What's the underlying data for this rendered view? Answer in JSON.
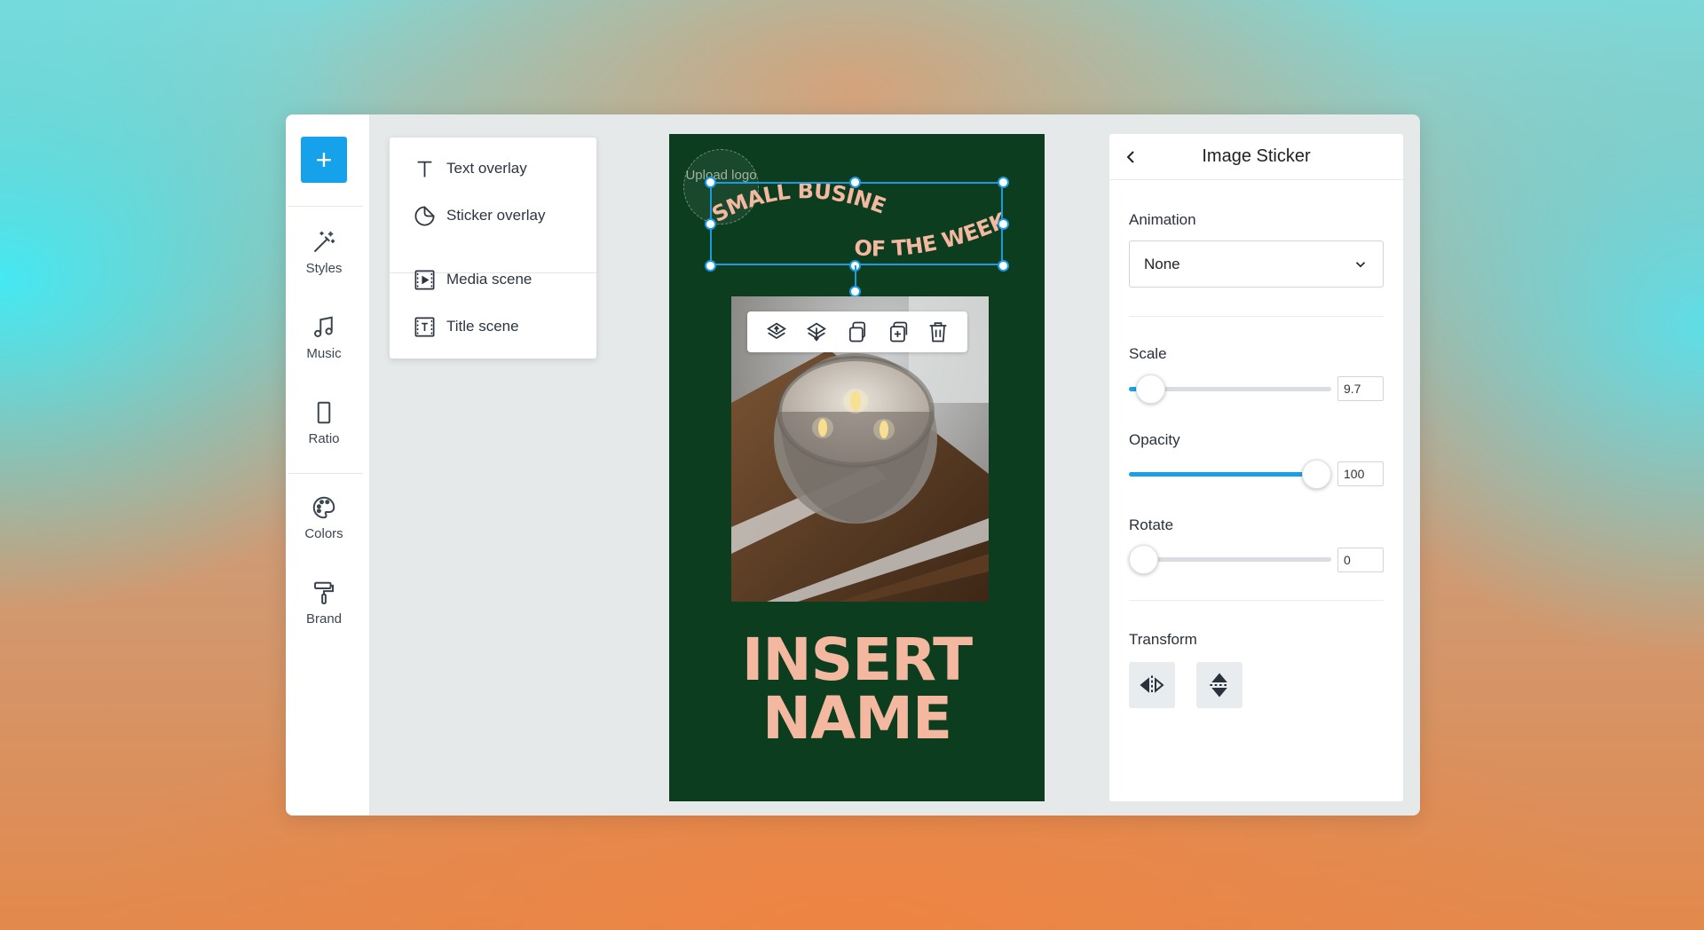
{
  "toolbar": {
    "add_label": "+"
  },
  "rail": {
    "items": [
      {
        "label": "Styles",
        "icon": "magic-wand-icon"
      },
      {
        "label": "Music",
        "icon": "music-note-icon"
      },
      {
        "label": "Ratio",
        "icon": "ratio-icon"
      },
      {
        "label": "Colors",
        "icon": "palette-icon"
      },
      {
        "label": "Brand",
        "icon": "paint-roller-icon"
      }
    ]
  },
  "add_menu": {
    "items": [
      {
        "label": "Text overlay",
        "icon": "text-icon"
      },
      {
        "label": "Sticker overlay",
        "icon": "sticker-icon"
      },
      {
        "label": "Media scene",
        "icon": "media-scene-icon"
      },
      {
        "label": "Title scene",
        "icon": "title-scene-icon"
      }
    ]
  },
  "canvas": {
    "upload_logo": "Upload logo",
    "headline_line1": "SMALL BUSINESS",
    "headline_line2": "OF THE WEEK",
    "name_line1": "INSERT",
    "name_line2": "NAME",
    "background_color": "#0c3d1f",
    "accent_color": "#f4b8a0",
    "selection_color": "#1d9be2"
  },
  "float_toolbar": {
    "icons": [
      "bring-forward-icon",
      "send-backward-icon",
      "copy-icon",
      "duplicate-icon",
      "delete-icon"
    ]
  },
  "panel": {
    "title": "Image Sticker",
    "animation_label": "Animation",
    "animation_value": "None",
    "scale_label": "Scale",
    "scale_value": "9.7",
    "scale_fraction": 0.04,
    "opacity_label": "Opacity",
    "opacity_value": "100",
    "opacity_fraction": 1.0,
    "rotate_label": "Rotate",
    "rotate_value": "0",
    "rotate_fraction": 0.0,
    "transform_label": "Transform",
    "accent_color": "#1aa0e6"
  }
}
